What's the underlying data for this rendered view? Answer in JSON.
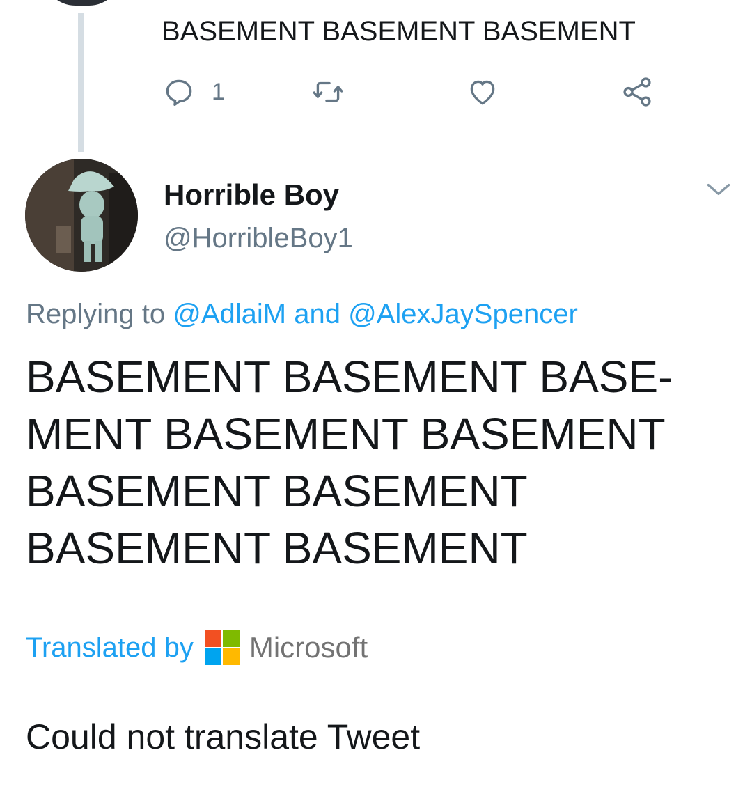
{
  "previous_tweet": {
    "text": "BASEMENT BASEMENT BASEMENT",
    "reply_count": "1"
  },
  "tweet": {
    "display_name": "Horrible Boy",
    "handle": "@HorribleBoy1",
    "replying_prefix": "Replying to",
    "replying_user_1": "@AdlaiM",
    "replying_and": "and",
    "replying_user_2": "@AlexJaySpencer",
    "lines": [
      "BASEMENT BASEMENT BASE-",
      "MENT BASEMENT BASEMENT",
      "BASEMENT BASEMENT",
      "BASEMENT BASEMENT"
    ]
  },
  "translation": {
    "label": "Translated by",
    "provider": "Microsoft",
    "status": "Could not translate Tweet"
  },
  "icons": {
    "reply": "reply-icon",
    "retweet": "retweet-icon",
    "like": "heart-icon",
    "share": "share-icon",
    "menu": "chevron-down-icon"
  },
  "colors": {
    "link": "#1da1f2",
    "muted": "#657786",
    "text": "#14171a",
    "ms_red": "#f25022",
    "ms_green": "#7fba00",
    "ms_blue": "#00a4ef",
    "ms_yellow": "#ffb900"
  }
}
